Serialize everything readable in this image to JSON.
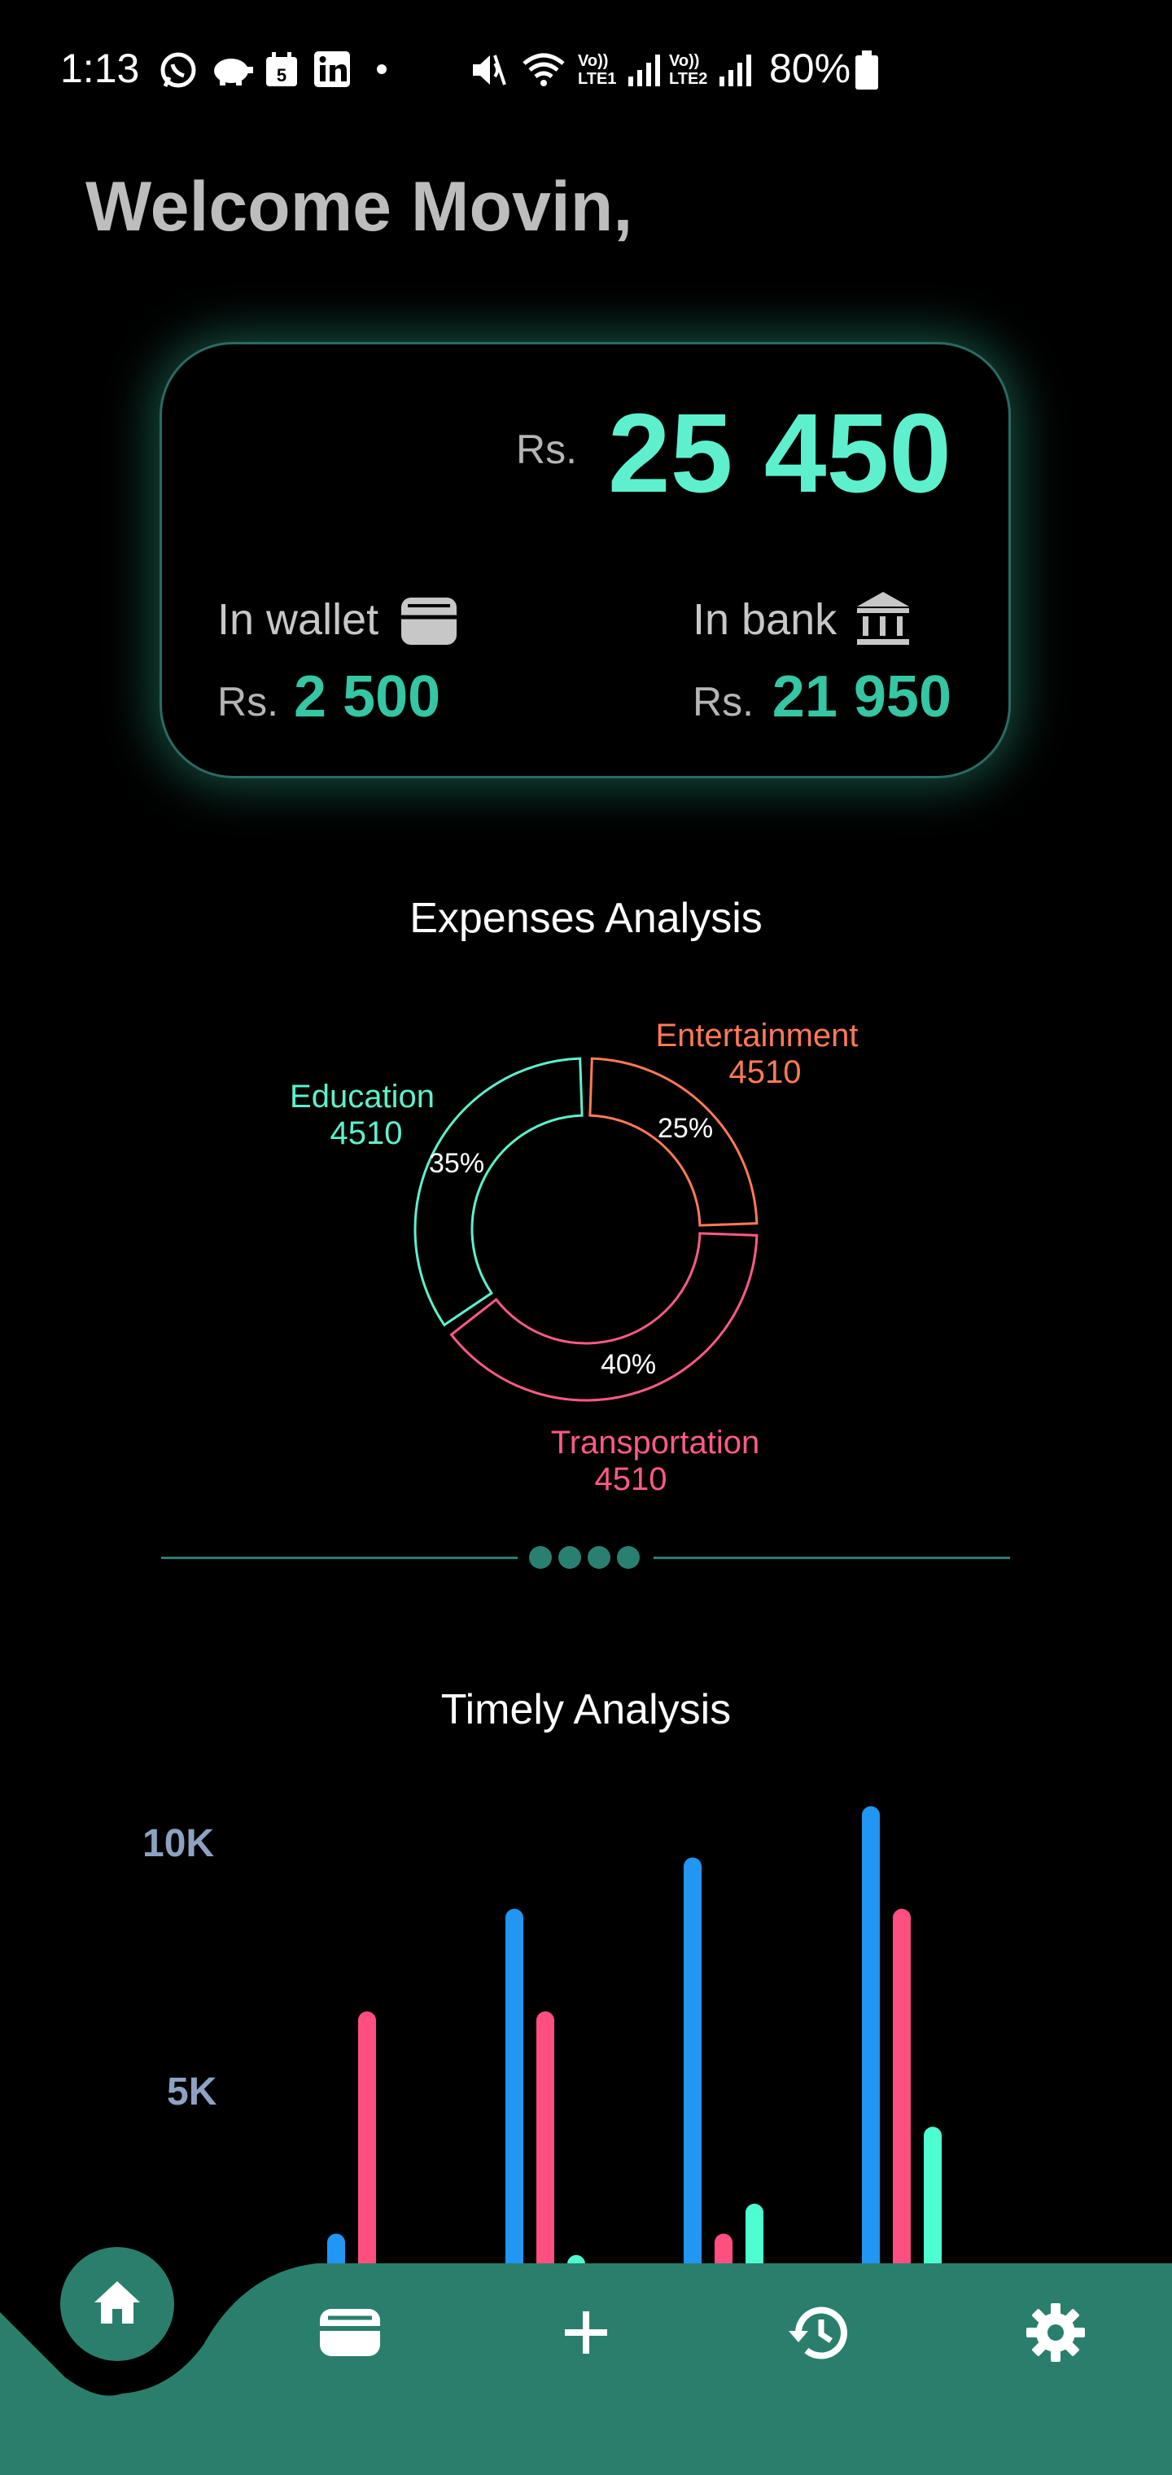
{
  "status_bar": {
    "time": "1:13",
    "battery": "80%",
    "left_icons": [
      "whatsapp-icon",
      "piggy-bank-icon",
      "calendar-icon",
      "linkedin-icon",
      "dot-icon"
    ],
    "right_icons": [
      "mute-icon",
      "wifi-icon",
      "volte1-icon",
      "signal1-icon",
      "volte2-icon",
      "signal2-icon",
      "battery-icon"
    ],
    "sim1_label": "Vo)) LTE1",
    "sim2_label": "Vo)) LTE2",
    "calendar_day": "5"
  },
  "welcome": "Welcome Movin,",
  "balance": {
    "currency": "Rs.",
    "total": "25 450",
    "wallet_label": "In wallet",
    "wallet_amount": "2 500",
    "bank_label": "In bank",
    "bank_amount": "21 950"
  },
  "expenses": {
    "title": "Expenses Analysis",
    "labels": {
      "education_name": "Education",
      "education_value": "4510",
      "education_pct": "35%",
      "entertainment_name": "Entertainment",
      "entertainment_value": "4510",
      "entertainment_pct": "25%",
      "transportation_name": "Transportation",
      "transportation_value": "4510",
      "transportation_pct": "40%"
    }
  },
  "timely": {
    "title": "Timely Analysis",
    "ytick_10k": "10K",
    "ytick_5k": "5K"
  },
  "colors": {
    "accent": "#5ef0cd",
    "education": "#5ef0cd",
    "entertainment": "#ff7a55",
    "transportation": "#ff5a85",
    "blue_series": "#2196f3",
    "pink_series": "#ff4f80",
    "teal_series": "#4dffd0",
    "nav_bg": "#2a7f6c"
  },
  "chart_data": [
    {
      "type": "pie",
      "title": "Expenses Analysis",
      "categories": [
        "Education",
        "Entertainment",
        "Transportation"
      ],
      "values": [
        4510,
        4510,
        4510
      ],
      "percent_labels": [
        35,
        25,
        40
      ],
      "colors": [
        "#5ef0cd",
        "#ff7a55",
        "#ff5a85"
      ],
      "style": "donut"
    },
    {
      "type": "bar",
      "title": "Timely Analysis",
      "yticks": [
        "5K",
        "10K"
      ],
      "ylim": [
        0,
        11500
      ],
      "categories": [
        "",
        "",
        "",
        ""
      ],
      "series": [
        {
          "color": "#2196f3",
          "values": [
            600,
            8200,
            9400,
            10600
          ]
        },
        {
          "color": "#ff4f80",
          "values": [
            5800,
            5800,
            600,
            8200
          ]
        },
        {
          "color": "#4dffd0",
          "values": [
            0,
            100,
            1300,
            3100
          ]
        }
      ],
      "truncated_by_nav": true
    }
  ],
  "nav": {
    "items": [
      "home-icon",
      "wallet-icon",
      "plus-icon",
      "history-icon",
      "settings-icon"
    ]
  }
}
